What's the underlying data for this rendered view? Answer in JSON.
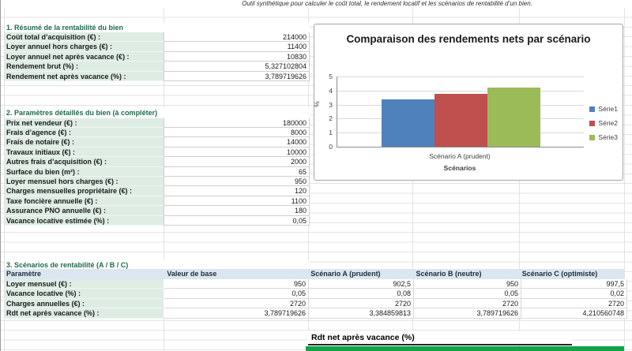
{
  "app": {
    "top_note": "Outil synthétique pour calculer le coût total, le rendement locatif et les scénarios de rentabilité d’un bien."
  },
  "colors": {
    "section_heading_text": "#1f6a4d",
    "label_cell_fill": "#deece4",
    "scenario_header_fill": "#dce6f1",
    "footer_green_bar": "#0ea447",
    "bar_blue": "#4F81BD",
    "bar_red": "#C0504D",
    "bar_green": "#9BBB59"
  },
  "sections": {
    "summary": {
      "heading": "1. Résumé de la rentabilité du bien",
      "rows": [
        {
          "label": "Coût total d’acquisition (€) :",
          "value": "214000"
        },
        {
          "label": "Loyer annuel hors charges (€) :",
          "value": "11400"
        },
        {
          "label": "Loyer annuel net après vacance (€) :",
          "value": "10830"
        },
        {
          "label": "Rendement brut (%) :",
          "value": "5,327102804"
        },
        {
          "label": "Rendement net après vacance (%) :",
          "value": "3,789719626"
        }
      ]
    },
    "params": {
      "heading": "2. Paramètres détaillés du bien (à compléter)",
      "rows": [
        {
          "label": "Prix net vendeur (€) :",
          "value": "180000"
        },
        {
          "label": "Frais d’agence (€) :",
          "value": "8000"
        },
        {
          "label": "Frais de notaire (€) :",
          "value": "14000"
        },
        {
          "label": "Travaux initiaux (€) :",
          "value": "10000"
        },
        {
          "label": "Autres frais d’acquisition (€) :",
          "value": "2000"
        },
        {
          "label": "Surface du bien (m²) :",
          "value": "65"
        },
        {
          "label": "Loyer mensuel hors charges (€) :",
          "value": "950"
        },
        {
          "label": "Charges mensuelles propriétaire (€) :",
          "value": "120"
        },
        {
          "label": "Taxe foncière annuelle (€) :",
          "value": "1100"
        },
        {
          "label": "Assurance PNO annuelle (€) :",
          "value": "180"
        },
        {
          "label": "Vacance locative estimée (%) :",
          "value": "0,05"
        }
      ]
    },
    "scenarios": {
      "heading": "3. Scénarios de rentabilité (A / B / C)",
      "headers": [
        "Paramètre",
        "Valeur de base",
        "Scénario A (prudent)",
        "Scénario B (neutre)",
        "Scénario C (optimiste)"
      ],
      "rows": [
        {
          "label": "Loyer mensuel (€) :",
          "base": "950",
          "a": "902,5",
          "b": "950",
          "c": "997,5"
        },
        {
          "label": "Vacance locative (%) :",
          "base": "0,05",
          "a": "0,08",
          "b": "0,05",
          "c": "0,02"
        },
        {
          "label": "Charges annuelles (€) :",
          "base": "2720",
          "a": "2720",
          "b": "2720",
          "c": "2720"
        },
        {
          "label": "Rdt net après vacance (%) :",
          "base": "3,789719626",
          "a": "3,384859813",
          "b": "3,789719626",
          "c": "4,210560748"
        }
      ]
    }
  },
  "footer": {
    "label": "Rdt net après vacance (%)"
  },
  "chart_data": {
    "type": "bar",
    "title": "Comparaison des rendements nets par scénario",
    "categories": [
      "Scénario A (prudent)"
    ],
    "series": [
      {
        "name": "Série1",
        "values": [
          3.384859813
        ],
        "color": "#4F81BD"
      },
      {
        "name": "Série2",
        "values": [
          3.789719626
        ],
        "color": "#C0504D"
      },
      {
        "name": "Série3",
        "values": [
          4.210560748
        ],
        "color": "#9BBB59"
      }
    ],
    "xlabel": "Scénarios",
    "ylabel": "%",
    "ylim": [
      0,
      5
    ],
    "ytick_step": 1,
    "grid": true,
    "legend_position": "right"
  }
}
